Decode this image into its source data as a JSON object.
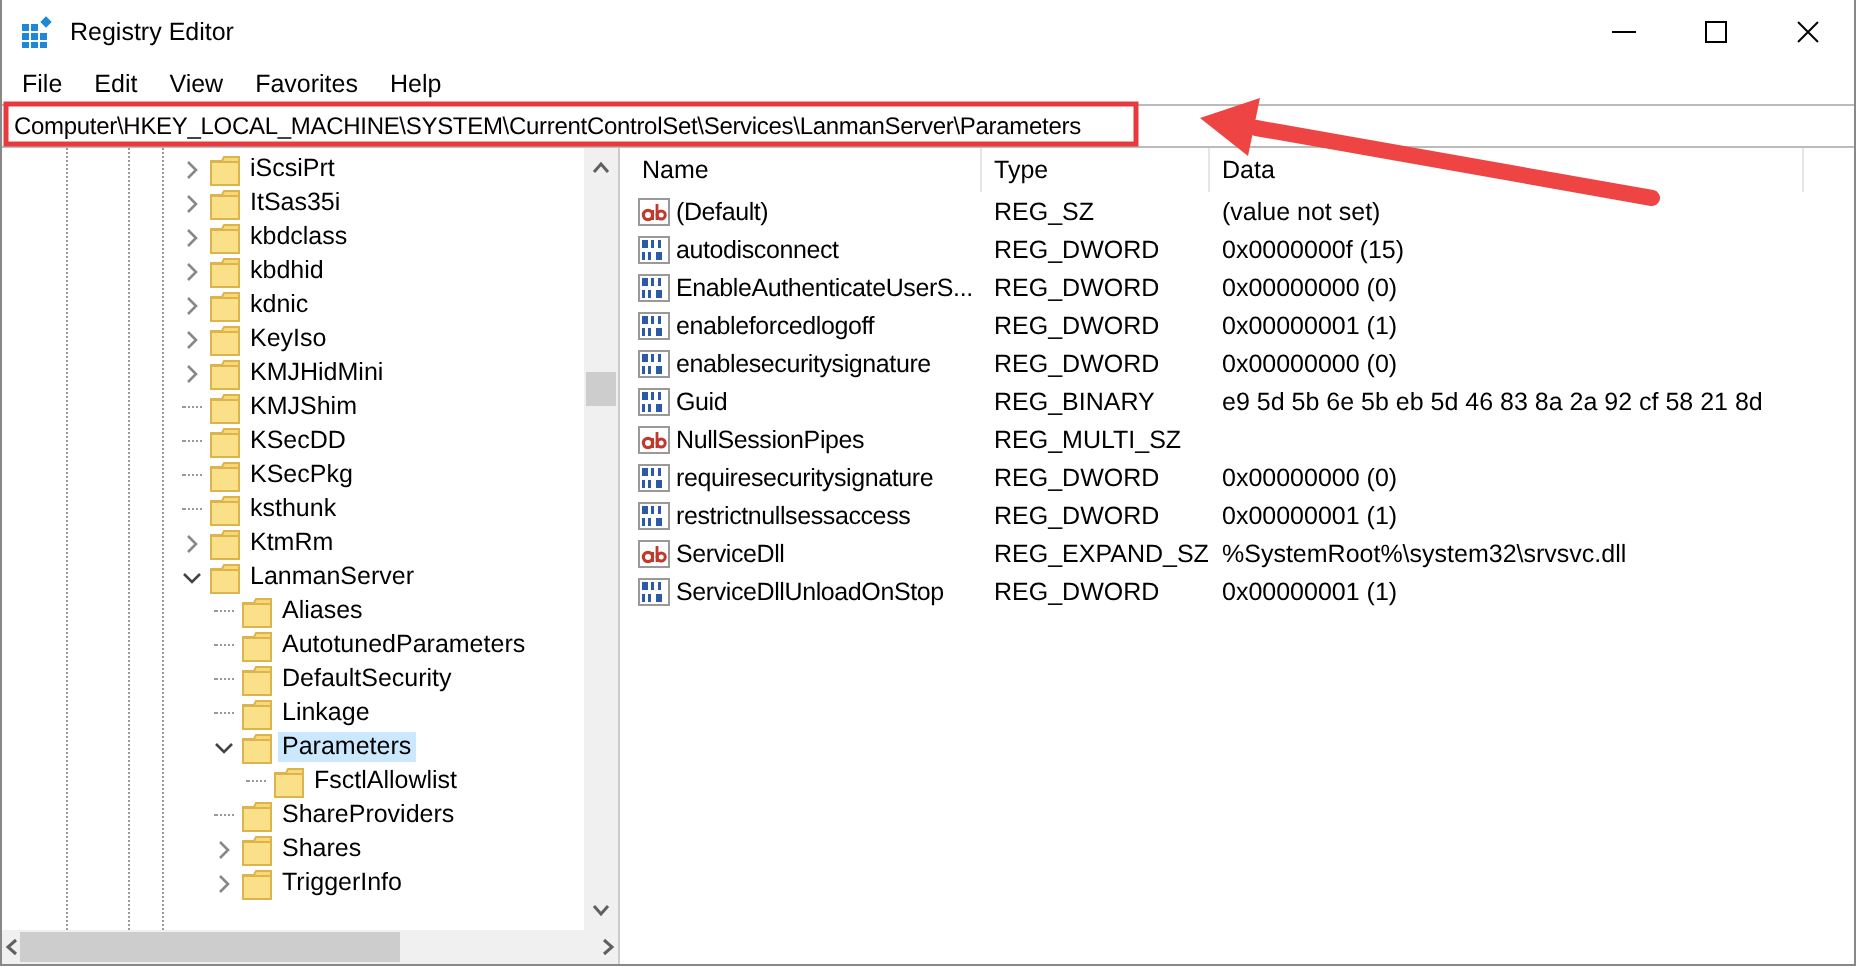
{
  "window": {
    "title": "Registry Editor"
  },
  "menu": [
    "File",
    "Edit",
    "View",
    "Favorites",
    "Help"
  ],
  "address": "Computer\\HKEY_LOCAL_MACHINE\\SYSTEM\\CurrentControlSet\\Services\\LanmanServer\\Parameters",
  "tree": [
    {
      "label": "iScsiPrt",
      "kind": "branch",
      "expanded": false,
      "selected": false
    },
    {
      "label": "ItSas35i",
      "kind": "branch",
      "expanded": false,
      "selected": false
    },
    {
      "label": "kbdclass",
      "kind": "branch",
      "expanded": false,
      "selected": false
    },
    {
      "label": "kbdhid",
      "kind": "branch",
      "expanded": false,
      "selected": false
    },
    {
      "label": "kdnic",
      "kind": "branch",
      "expanded": false,
      "selected": false
    },
    {
      "label": "KeyIso",
      "kind": "branch",
      "expanded": false,
      "selected": false
    },
    {
      "label": "KMJHidMini",
      "kind": "branch",
      "expanded": false,
      "selected": false
    },
    {
      "label": "KMJShim",
      "kind": "leaf",
      "selected": false
    },
    {
      "label": "KSecDD",
      "kind": "leaf",
      "selected": false
    },
    {
      "label": "KSecPkg",
      "kind": "leaf",
      "selected": false
    },
    {
      "label": "ksthunk",
      "kind": "leaf",
      "selected": false
    },
    {
      "label": "KtmRm",
      "kind": "branch",
      "expanded": false,
      "selected": false
    },
    {
      "label": "LanmanServer",
      "kind": "branch",
      "expanded": true,
      "selected": false,
      "children": [
        {
          "label": "Aliases",
          "kind": "leaf",
          "selected": false
        },
        {
          "label": "AutotunedParameters",
          "kind": "leaf",
          "selected": false
        },
        {
          "label": "DefaultSecurity",
          "kind": "leaf",
          "selected": false
        },
        {
          "label": "Linkage",
          "kind": "leaf",
          "selected": false
        },
        {
          "label": "Parameters",
          "kind": "branch",
          "expanded": true,
          "selected": true,
          "children": [
            {
              "label": "FsctlAllowlist",
              "kind": "leaf",
              "selected": false
            }
          ]
        },
        {
          "label": "ShareProviders",
          "kind": "leaf",
          "selected": false
        },
        {
          "label": "Shares",
          "kind": "branch",
          "expanded": false,
          "selected": false
        },
        {
          "label": "TriggerInfo",
          "kind": "branch",
          "expanded": false,
          "selected": false
        }
      ]
    }
  ],
  "table": {
    "columns": [
      "Name",
      "Type",
      "Data"
    ],
    "rows": [
      {
        "kind": "string",
        "name": "(Default)",
        "type": "REG_SZ",
        "data": "(value not set)"
      },
      {
        "kind": "binary",
        "name": "autodisconnect",
        "type": "REG_DWORD",
        "data": "0x0000000f (15)"
      },
      {
        "kind": "binary",
        "name": "EnableAuthenticateUserS...",
        "type": "REG_DWORD",
        "data": "0x00000000 (0)"
      },
      {
        "kind": "binary",
        "name": "enableforcedlogoff",
        "type": "REG_DWORD",
        "data": "0x00000001 (1)"
      },
      {
        "kind": "binary",
        "name": "enablesecuritysignature",
        "type": "REG_DWORD",
        "data": "0x00000000 (0)"
      },
      {
        "kind": "binary",
        "name": "Guid",
        "type": "REG_BINARY",
        "data": "e9 5d 5b 6e 5b eb 5d 46 83 8a 2a 92 cf 58 21 8d"
      },
      {
        "kind": "string",
        "name": "NullSessionPipes",
        "type": "REG_MULTI_SZ"
      },
      {
        "kind": "binary",
        "name": "requiresecuritysignature",
        "type": "REG_DWORD",
        "data": "0x00000000 (0)"
      },
      {
        "kind": "binary",
        "name": "restrictnullsessaccess",
        "type": "REG_DWORD",
        "data": "0x00000001 (1)"
      },
      {
        "kind": "string",
        "name": "ServiceDll",
        "type": "REG_EXPAND_SZ",
        "data": "%SystemRoot%\\system32\\srvsvc.dll"
      },
      {
        "kind": "binary",
        "name": "ServiceDllUnloadOnStop",
        "type": "REG_DWORD",
        "data": "0x00000001 (1)"
      }
    ]
  }
}
